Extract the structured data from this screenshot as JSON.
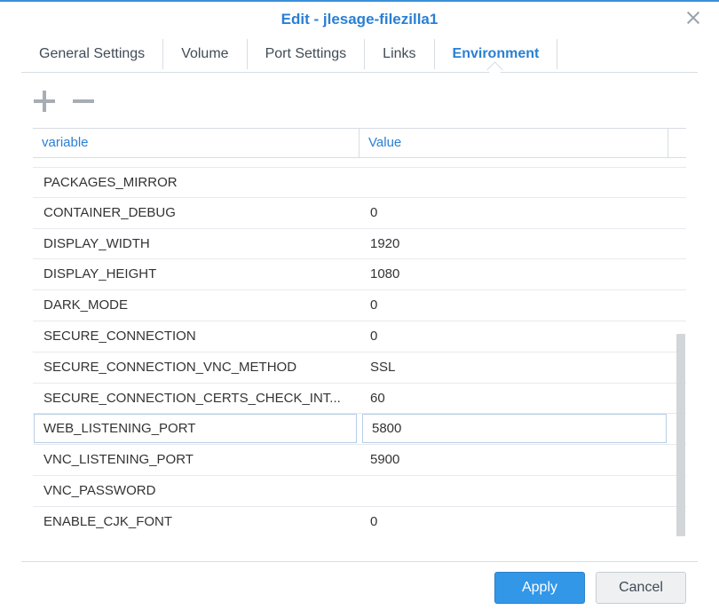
{
  "dialog": {
    "title": "Edit - jlesage-filezilla1",
    "tabs": [
      {
        "label": "General Settings",
        "active": false
      },
      {
        "label": "Volume",
        "active": false
      },
      {
        "label": "Port Settings",
        "active": false
      },
      {
        "label": "Links",
        "active": false
      },
      {
        "label": "Environment",
        "active": true
      }
    ]
  },
  "toolbar": {
    "add_icon": "plus-icon",
    "remove_icon": "minus-icon"
  },
  "grid": {
    "columns": [
      "variable",
      "Value"
    ],
    "rows": [
      {
        "variable": "PACKAGES_MIRROR",
        "value": ""
      },
      {
        "variable": "CONTAINER_DEBUG",
        "value": "0"
      },
      {
        "variable": "DISPLAY_WIDTH",
        "value": "1920"
      },
      {
        "variable": "DISPLAY_HEIGHT",
        "value": "1080"
      },
      {
        "variable": "DARK_MODE",
        "value": "0"
      },
      {
        "variable": "SECURE_CONNECTION",
        "value": "0"
      },
      {
        "variable": "SECURE_CONNECTION_VNC_METHOD",
        "value": "SSL"
      },
      {
        "variable": "SECURE_CONNECTION_CERTS_CHECK_INT...",
        "value": "60"
      },
      {
        "variable": "WEB_LISTENING_PORT",
        "value": "5800",
        "editing": true
      },
      {
        "variable": "VNC_LISTENING_PORT",
        "value": "5900"
      },
      {
        "variable": "VNC_PASSWORD",
        "value": ""
      },
      {
        "variable": "ENABLE_CJK_FONT",
        "value": "0"
      }
    ]
  },
  "footer": {
    "apply_label": "Apply",
    "cancel_label": "Cancel"
  },
  "colors": {
    "accent": "#2a7fd4",
    "apply_button": "#3397e8"
  }
}
